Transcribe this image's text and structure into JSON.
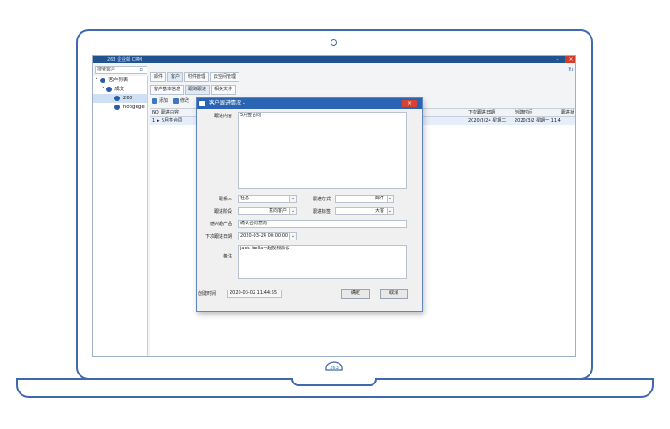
{
  "window": {
    "title": "263 企业邮 CRM",
    "min_label": "–",
    "close_label": "×"
  },
  "sidebar": {
    "search_placeholder": "搜索客户",
    "items": [
      {
        "label": "客户列表"
      },
      {
        "label": "成交"
      },
      {
        "label": "263"
      },
      {
        "label": "hoogege"
      }
    ]
  },
  "top_tabs": [
    {
      "label": "邮件"
    },
    {
      "label": "客户"
    },
    {
      "label": "附件管理"
    },
    {
      "label": "云空间管理"
    }
  ],
  "sub_tabs": [
    {
      "label": "客户基本信息"
    },
    {
      "label": "跟踪跟进"
    },
    {
      "label": "相关文件"
    }
  ],
  "toolbar": {
    "add": "添加",
    "edit": "修改"
  },
  "grid": {
    "headers": {
      "no": "NO",
      "content": "跟进内容",
      "next_date": "下次跟进日期",
      "created": "创建时间",
      "status": "跟进状"
    },
    "row": {
      "no": "1",
      "content": "5月签合同",
      "next_date": "2020/3/24 星期二",
      "created": "2020/3/2 星期一 11:4"
    }
  },
  "dialog": {
    "title": "客户跟进情况 -",
    "close_label": "×",
    "content_label": "跟进内容",
    "content_value": "5月签合同",
    "contact_label": "联系人",
    "contact_value": "杜总",
    "method_label": "跟进方式",
    "method_value": "邮件",
    "stage_label": "跟进阶段",
    "stage_value": "意向客户",
    "tag_label": "跟进标签",
    "tag_value": "大客",
    "product_label": "感兴趣产品",
    "product_value": "确认合同意向",
    "next_date_label": "下次跟进日期",
    "next_date_value": "2020-03-24 00:00:00",
    "note_label": "备注",
    "note_value": "jack. bella一起视频会议",
    "created_label": "创建时间",
    "created_value": "2020-03-02 11:44:55",
    "ok_label": "确定",
    "cancel_label": "取消",
    "dropdown_glyph": "⌄"
  },
  "brand": {
    "logo_text": "263",
    "accent": "#3f69ae"
  }
}
